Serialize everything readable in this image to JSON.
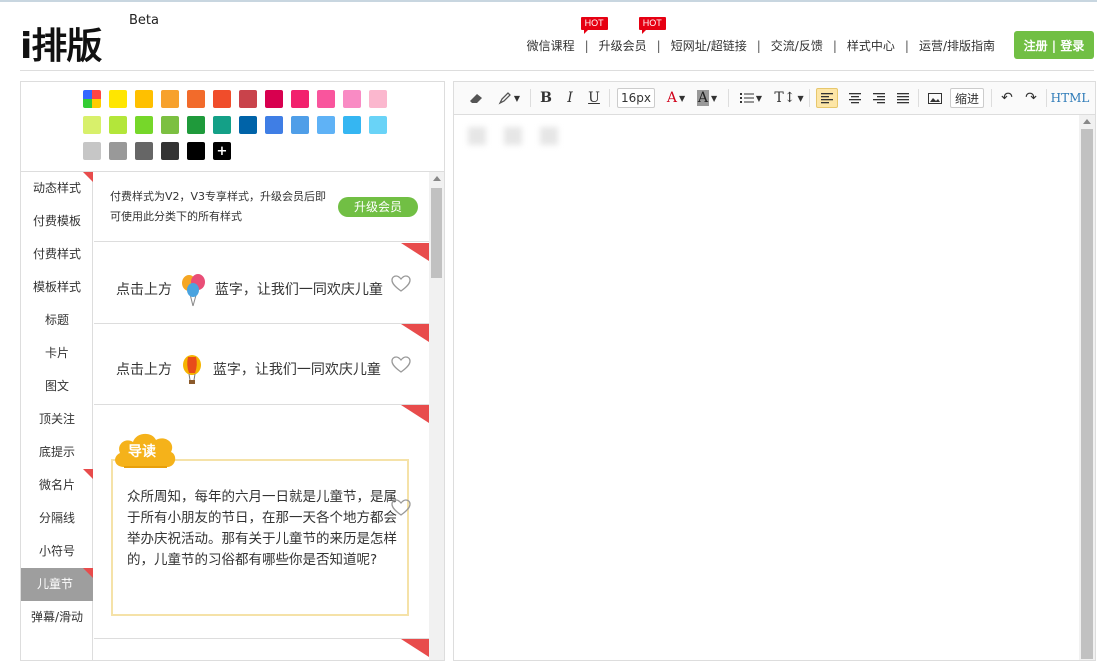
{
  "header": {
    "logo": "i排版",
    "logo_beta": "Beta",
    "nav": [
      {
        "label": "微信课程",
        "hot": false
      },
      {
        "label": "升级会员",
        "hot": true
      },
      {
        "label": "短网址/超链接",
        "hot": true
      },
      {
        "label": "交流/反馈",
        "hot": false
      },
      {
        "label": "样式中心",
        "hot": false
      },
      {
        "label": "运营/排版指南",
        "hot": false
      }
    ],
    "hot_badge": "HOT",
    "login_button": "注册 | 登录",
    "accent_color": "#71bf44"
  },
  "palette": {
    "colors": [
      "#ffe600",
      "#ffc000",
      "#f7a12c",
      "#f26b2b",
      "#f04d2b",
      "#c9434b",
      "#d8004f",
      "#f2206d",
      "#f9559d",
      "#f98bc4",
      "#fbb7ce",
      "#d8f06b",
      "#b3e63a",
      "#76d72a",
      "#7cc041",
      "#1f9a3b",
      "#14a087",
      "#0063a8",
      "#3f7ee5",
      "#4f9ee8",
      "#5fb2f6",
      "#35b6f2",
      "#69d3f7",
      "#c6c6c6",
      "#999999",
      "#666666",
      "#333333",
      "#000000"
    ],
    "add_label": "+"
  },
  "categories": [
    "动态样式",
    "付费模板",
    "付费样式",
    "模板样式",
    "标题",
    "卡片",
    "图文",
    "顶关注",
    "底提示",
    "微名片",
    "分隔线",
    "小符号",
    "儿童节",
    "弹幕/滑动"
  ],
  "active_category": "儿童节",
  "promo": {
    "text": "付费样式为V2，V3专享样式，升级会员后即可使用此分类下的所有样式",
    "button": "升级会员"
  },
  "style_cards": [
    {
      "before": "点击上方",
      "icon": "balloons-icon",
      "after": "蓝字，让我们一同欢庆儿童"
    },
    {
      "before": "点击上方",
      "icon": "hot-air-balloon-icon",
      "after": "蓝字，让我们一同欢庆儿童"
    }
  ],
  "guide_card": {
    "badge": "导读",
    "text": "众所周知，每年的六月一日就是儿童节，是属于所有小朋友的节日，在那一天各个地方都会举办庆祝活动。那有关于儿童节的来历是怎样的，儿童节的习俗都有哪些你是否知道呢?"
  },
  "toolbar": {
    "font_size": "16px",
    "indent": "缩进",
    "html": "HTML"
  }
}
